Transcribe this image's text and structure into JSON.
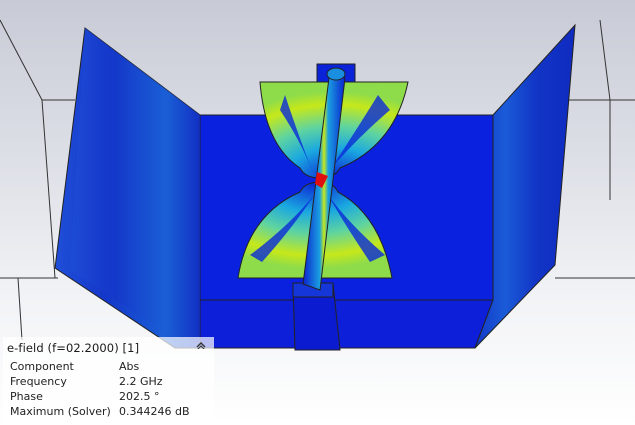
{
  "viewport": {
    "name": "3D field view",
    "colors": {
      "background_top": "#c8cbd6",
      "background_bottom": "#ffffff",
      "field_low": "#0a1fd6",
      "field_mid": "#1aa8e0",
      "field_high": "#c6e81a",
      "field_max": "#e01010"
    }
  },
  "legend": {
    "title": "e-field (f=02.2000) [1]",
    "collapse_icon": "chevron-up-icon",
    "rows": [
      {
        "key": "Component",
        "value": "Abs"
      },
      {
        "key": "Frequency",
        "value": "2.2 GHz"
      },
      {
        "key": "Phase",
        "value": "202.5 °"
      },
      {
        "key": "Maximum (Solver)",
        "value": "0.344246 dB"
      }
    ]
  }
}
